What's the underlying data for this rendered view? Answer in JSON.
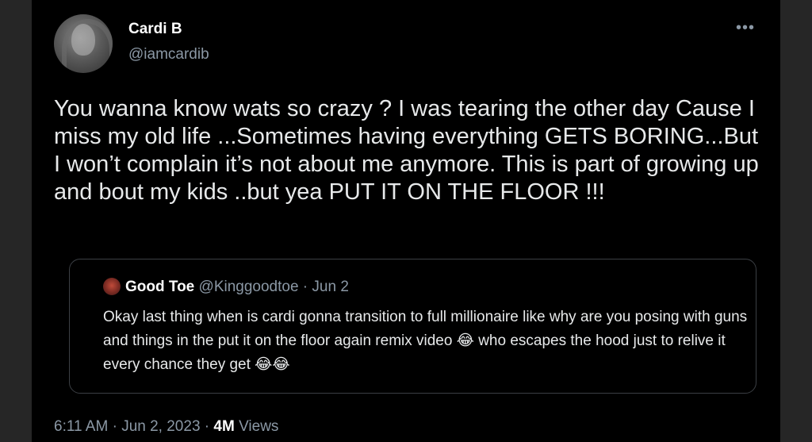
{
  "author": {
    "name": "Cardi B",
    "handle": "@iamcardib"
  },
  "more_icon": "more-horizontal-icon",
  "tweet_text": "You wanna know wats so crazy ? I was tearing the other day Cause I miss my old life ...Sometimes having everything GETS BORING...But I won’t complain it’s not about me anymore. This is part of growing up and bout my kids ..but yea PUT IT ON THE FLOOR !!!",
  "quoted": {
    "name": "Good Toe",
    "handle": "@Kinggoodtoe",
    "separator": " · ",
    "date": "Jun 2",
    "text": "Okay last thing when is cardi gonna transition to full millionaire like why are you posing with guns and things in the put it on the floor again remix video 😂 who escapes the hood just to relive it every chance they get 😂😂"
  },
  "footer": {
    "time": "6:11 AM",
    "separator": " · ",
    "date": "Jun 2, 2023",
    "views_count": "4M",
    "views_label": " Views"
  },
  "colors": {
    "background": "#000000",
    "text": "#e7e9ea",
    "secondary": "#8b98a5",
    "border": "#3b3f44"
  }
}
